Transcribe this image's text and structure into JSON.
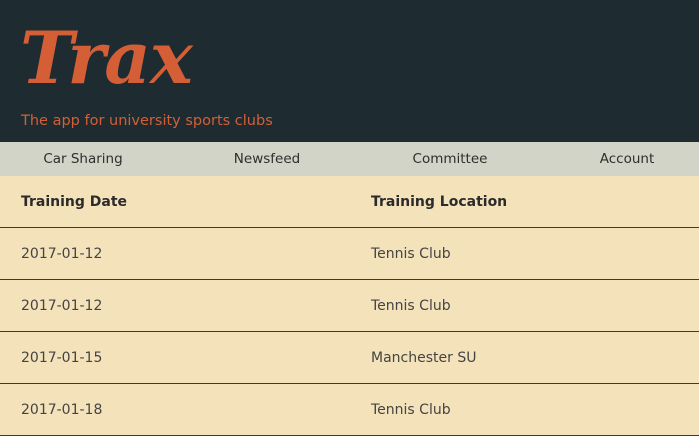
{
  "header": {
    "logo": "Trax",
    "tagline": "The app for university sports clubs"
  },
  "nav": {
    "items": [
      {
        "label": "Car Sharing"
      },
      {
        "label": "Newsfeed"
      },
      {
        "label": "Committee"
      },
      {
        "label": "Account"
      }
    ]
  },
  "table": {
    "columns": [
      "Training Date",
      "Training Location"
    ],
    "rows": [
      {
        "date": "2017-01-12",
        "location": "Tennis Club"
      },
      {
        "date": "2017-01-12",
        "location": "Tennis Club"
      },
      {
        "date": "2017-01-15",
        "location": "Manchester SU"
      },
      {
        "date": "2017-01-18",
        "location": "Tennis Club"
      }
    ]
  },
  "colors": {
    "header_bg": "#1e2b30",
    "accent": "#d45f36",
    "nav_bg": "#d3d4c8",
    "content_bg": "#f4e2bb"
  }
}
